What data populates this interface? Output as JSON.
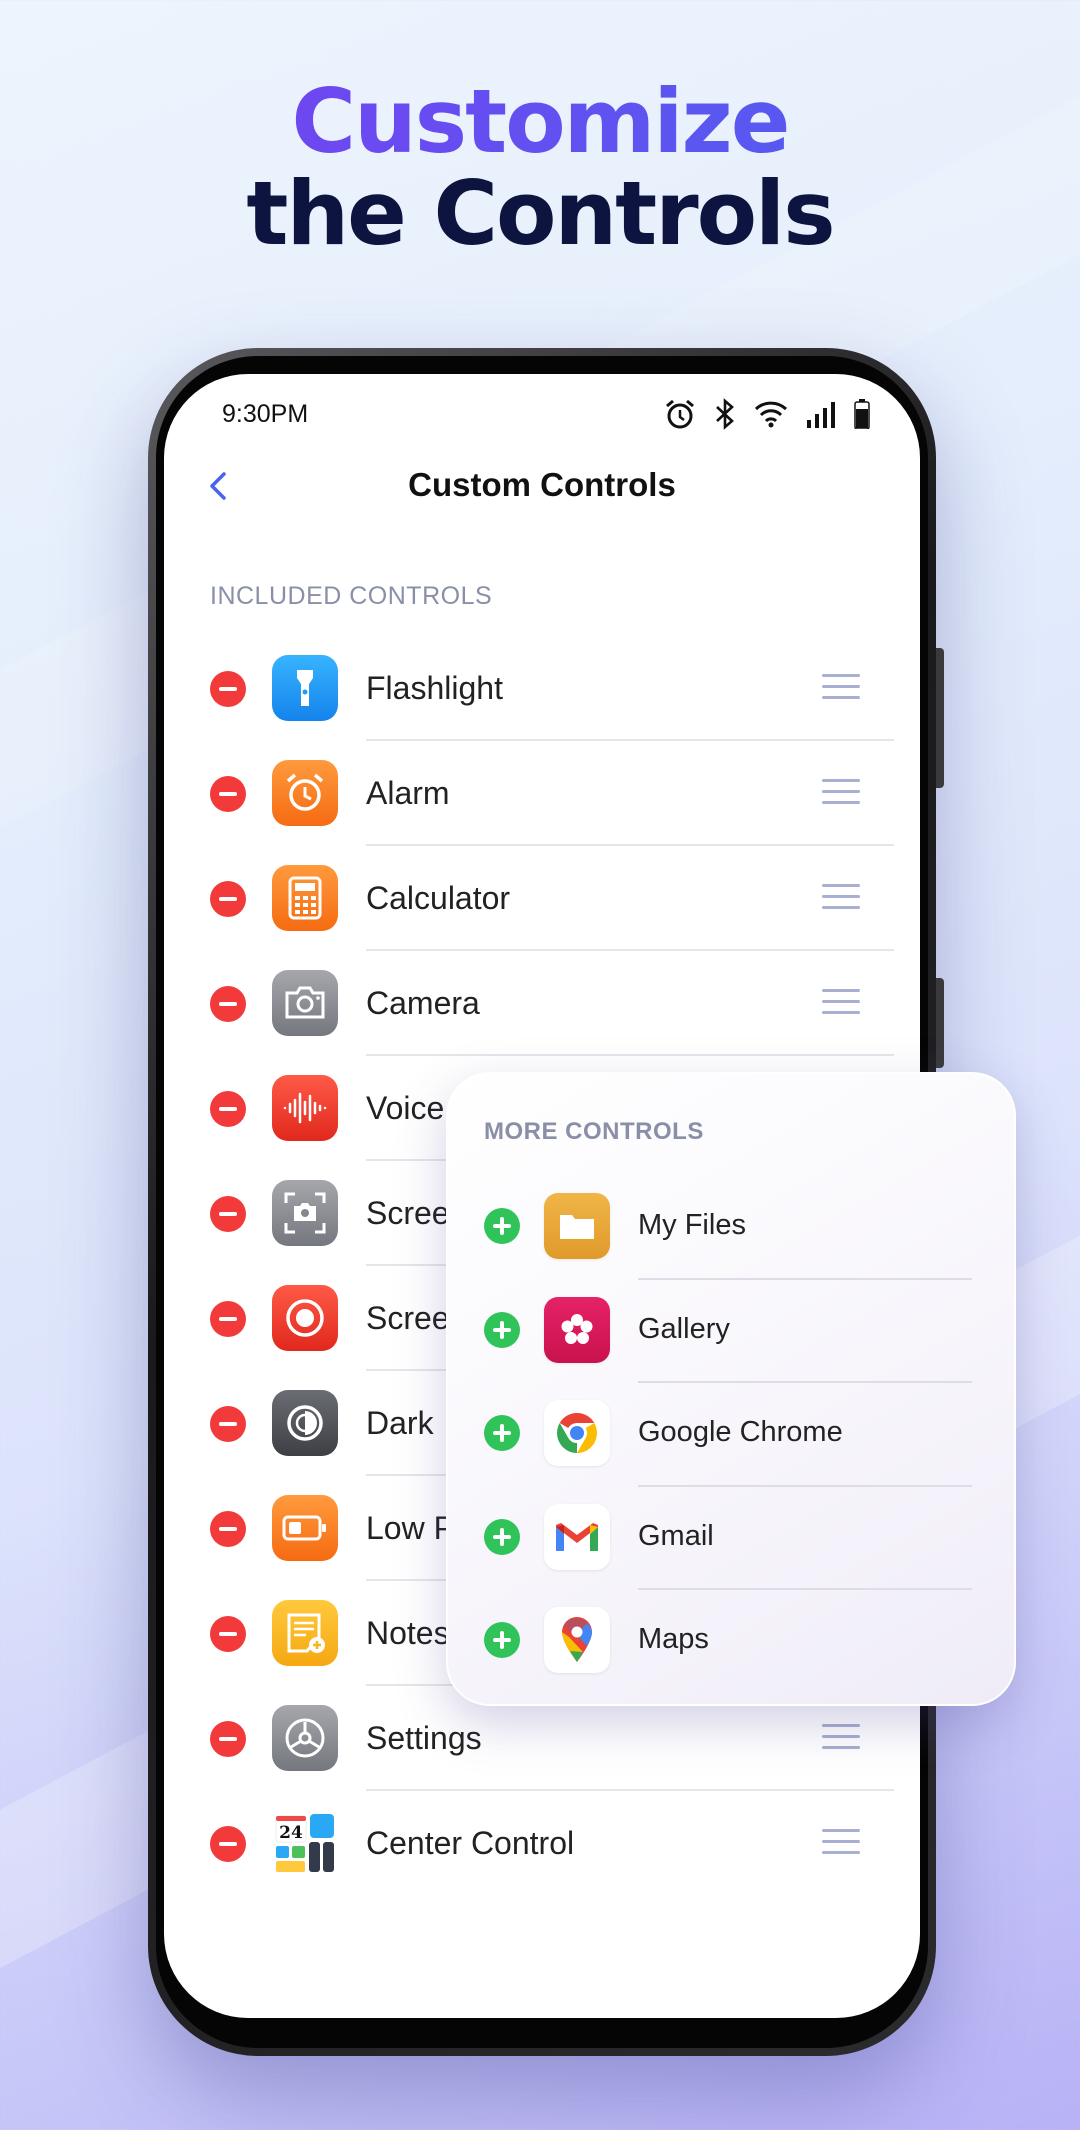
{
  "headline": {
    "line1": "Customize",
    "line2": "the Controls"
  },
  "status_bar": {
    "time": "9:30PM",
    "icons": [
      "alarm-icon",
      "bluetooth-icon",
      "wifi-icon",
      "signal-icon",
      "battery-icon"
    ]
  },
  "nav": {
    "title": "Custom Controls",
    "back_icon": "chevron-left-icon"
  },
  "included": {
    "label": "INCLUDED CONTROLS",
    "items": [
      {
        "label": "Flashlight",
        "icon": "flashlight-icon",
        "color": "#1e9cf5"
      },
      {
        "label": "Alarm",
        "icon": "alarm-clock-icon",
        "color": "#f57b1e"
      },
      {
        "label": "Calculator",
        "icon": "calculator-icon",
        "color": "#f5801e"
      },
      {
        "label": "Camera",
        "icon": "camera-icon",
        "color": "#8a8c93"
      },
      {
        "label": "Voice",
        "icon": "voice-recorder-icon",
        "color": "#ee3a2f"
      },
      {
        "label": "Scree",
        "icon": "screenshot-icon",
        "color": "#85878e"
      },
      {
        "label": "Scree",
        "icon": "screen-record-icon",
        "color": "#ee3a2f"
      },
      {
        "label": "Dark",
        "icon": "dark-mode-icon",
        "color": "#55575e"
      },
      {
        "label": "Low P",
        "icon": "low-power-icon",
        "color": "#f57b1e"
      },
      {
        "label": "Notes",
        "icon": "notes-icon",
        "color": "#f5b81e"
      },
      {
        "label": "Settings",
        "icon": "settings-icon",
        "color": "#85878e"
      },
      {
        "label": "Center Control",
        "icon": "center-control-icon",
        "color": "#ffffff",
        "date": "24"
      }
    ]
  },
  "more": {
    "label": "MORE CONTROLS",
    "items": [
      {
        "label": "My Files",
        "icon": "folder-icon",
        "color": "#e8a53a"
      },
      {
        "label": "Gallery",
        "icon": "gallery-flower-icon",
        "color": "#d81b5c"
      },
      {
        "label": "Google Chrome",
        "icon": "chrome-icon",
        "color": "#ffffff"
      },
      {
        "label": "Gmail",
        "icon": "gmail-icon",
        "color": "#ffffff"
      },
      {
        "label": "Maps",
        "icon": "maps-pin-icon",
        "color": "#ffffff"
      }
    ]
  },
  "colors": {
    "remove": "#f23a3a",
    "add": "#2fc35a",
    "accent": "#4a63ef",
    "handle": "#a8afd0"
  }
}
